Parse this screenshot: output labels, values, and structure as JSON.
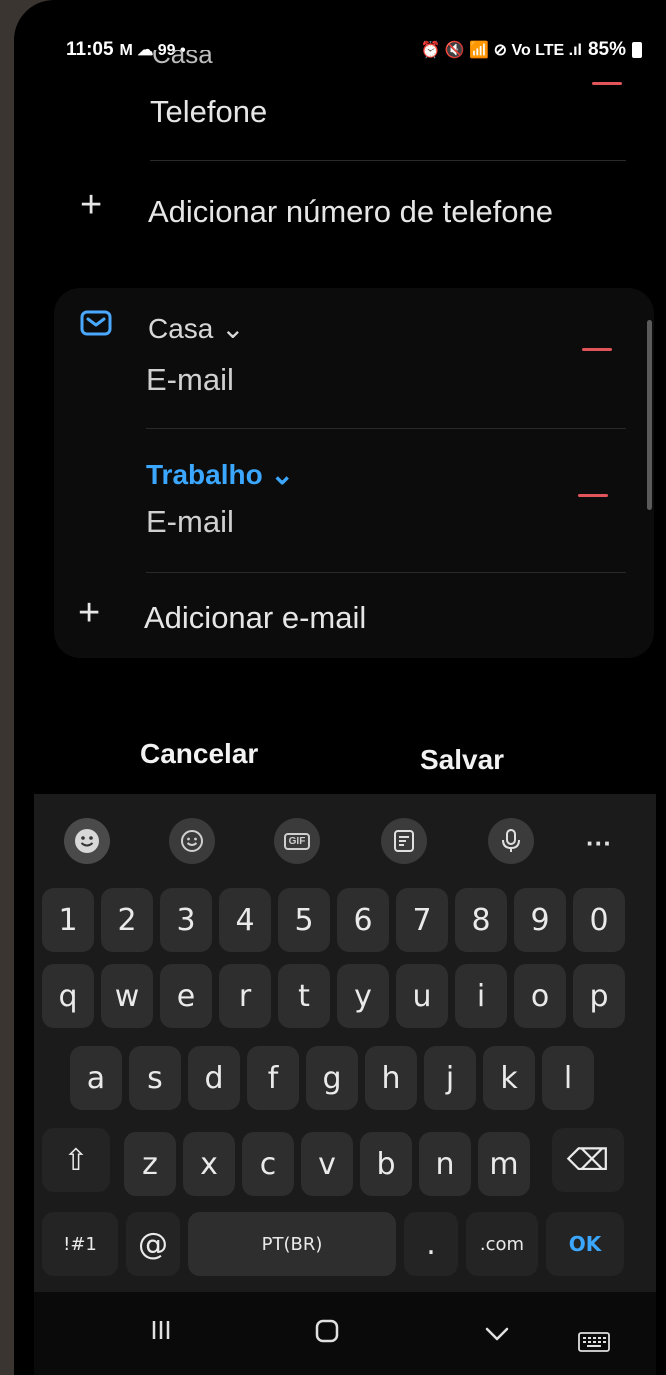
{
  "status_bar": {
    "time": "11:05",
    "left_icons": "M ☁ 99 •",
    "right_icons": "⏰ 🔇 📶 ⊘ Vo LTE .ıl",
    "battery": "85%"
  },
  "phone_section": {
    "partial_label": "Casa",
    "field": "Telefone",
    "add_label": "Adicionar número de telefone"
  },
  "email_section": {
    "entries": [
      {
        "type_label": "Casa ⌄",
        "placeholder": "E-mail"
      },
      {
        "type_label": "Trabalho ⌄",
        "placeholder": "E-mail"
      }
    ],
    "add_label": "Adicionar e-mail"
  },
  "actions": {
    "cancel": "Cancelar",
    "save": "Salvar"
  },
  "keyboard": {
    "toolbar": {
      "more": "···",
      "gif": "GIF"
    },
    "row_numbers": [
      "1",
      "2",
      "3",
      "4",
      "5",
      "6",
      "7",
      "8",
      "9",
      "0"
    ],
    "row1": [
      "q",
      "w",
      "e",
      "r",
      "t",
      "y",
      "u",
      "i",
      "o",
      "p"
    ],
    "row2": [
      "a",
      "s",
      "d",
      "f",
      "g",
      "h",
      "j",
      "k",
      "l"
    ],
    "row3": [
      "z",
      "x",
      "c",
      "v",
      "b",
      "n",
      "m"
    ],
    "shift": "⇧",
    "backspace": "⌫",
    "symbols": "!#1",
    "at": "@",
    "space": "PT(BR)",
    "dot": ".",
    "dotcom": ".com",
    "ok": "OK"
  }
}
